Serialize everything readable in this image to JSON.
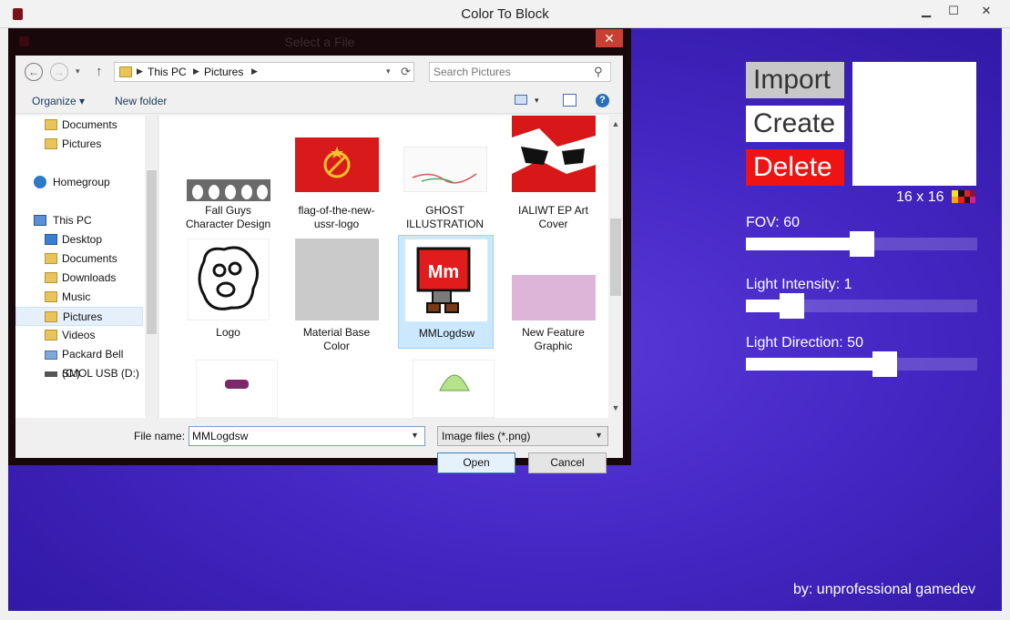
{
  "window": {
    "title": "Color To Block",
    "min": "▁",
    "max": "☐",
    "close": "✕"
  },
  "app": {
    "buttons": {
      "import": "Import",
      "create": "Create",
      "delete": "Delete"
    },
    "size_label": "16 x 16",
    "sliders": [
      {
        "label": "FOV: 60",
        "value": 0.5
      },
      {
        "label": "Light Intensity: 1",
        "value": 0.2
      },
      {
        "label": "Light Direction: 50",
        "value": 0.6
      }
    ],
    "credit": "by: unprofessional gamedev",
    "colors": {
      "background": "#4a2bd0",
      "delete": "#ee1414",
      "import": "#c8c8c8"
    }
  },
  "dialog": {
    "title": "Select a File",
    "close": "✕",
    "nav": {
      "back": "←",
      "forward": "→",
      "recent": "▾",
      "up": "↑"
    },
    "breadcrumb": [
      "This PC",
      "Pictures"
    ],
    "address_dd": "▾",
    "refresh": "⟳",
    "search": {
      "placeholder": "Search Pictures",
      "icon": "⚲"
    },
    "toolbar": {
      "organize": "Organize ▾",
      "new_folder": "New folder",
      "view_dd": "▾",
      "help": "?"
    },
    "nav_pane": {
      "items": [
        {
          "label": "Documents",
          "type": "folder",
          "root": false
        },
        {
          "label": "Pictures",
          "type": "folder",
          "root": false
        },
        {
          "label": "Homegroup",
          "type": "homegroup",
          "root": true
        },
        {
          "label": "This PC",
          "type": "pc",
          "root": true
        },
        {
          "label": "Desktop",
          "type": "folder",
          "root": false
        },
        {
          "label": "Documents",
          "type": "folder",
          "root": false
        },
        {
          "label": "Downloads",
          "type": "folder",
          "root": false
        },
        {
          "label": "Music",
          "type": "folder",
          "root": false
        },
        {
          "label": "Pictures",
          "type": "folder",
          "root": false,
          "selected": true
        },
        {
          "label": "Videos",
          "type": "folder",
          "root": false
        },
        {
          "label": "Packard Bell (C:)",
          "type": "drive",
          "root": false
        },
        {
          "label": "SMOL USB (D:)",
          "type": "usb",
          "root": false
        }
      ]
    },
    "files": [
      {
        "name": "Fall Guys Character Design",
        "thumb": "fallguys"
      },
      {
        "name": "flag-of-the-new-ussr-logo",
        "thumb": "ussr"
      },
      {
        "name": "GHOST ILLUSTRATION",
        "thumb": "ghost"
      },
      {
        "name": "IALIWT EP Art Cover",
        "thumb": "ialiwt"
      },
      {
        "name": "Logo",
        "thumb": "logo"
      },
      {
        "name": "Material Base Color",
        "thumb": "grey"
      },
      {
        "name": "MMLogdsw",
        "thumb": "mm",
        "selected": true
      },
      {
        "name": "New Feature Graphic",
        "thumb": "pink"
      }
    ],
    "file_name_label": "File name:",
    "file_name_value": "MMLogdsw",
    "file_type": "Image files (*.png)",
    "open": "Open",
    "cancel": "Cancel",
    "scroll_up": "▲",
    "scroll_down": "▼"
  }
}
